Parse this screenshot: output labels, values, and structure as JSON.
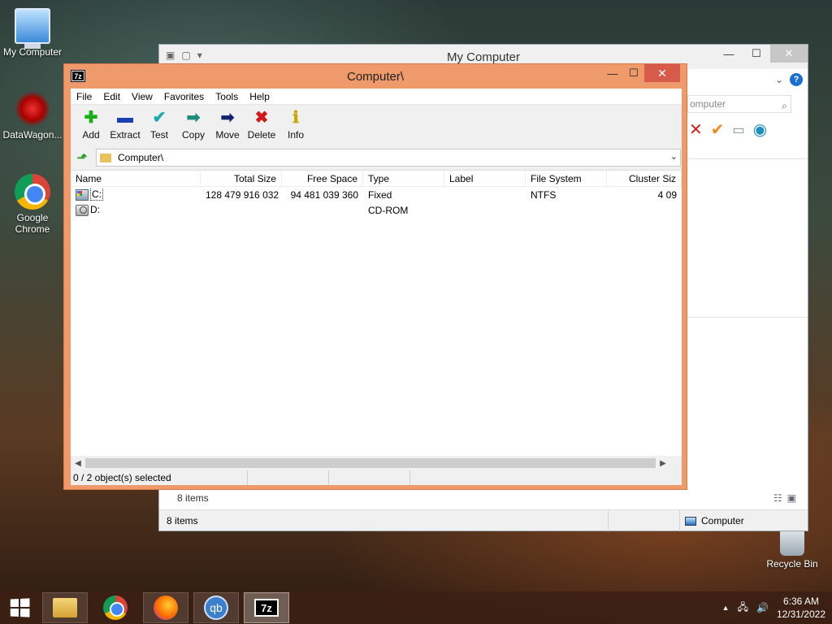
{
  "desktop": {
    "icons": [
      {
        "label": "My Computer"
      },
      {
        "label": "DataWagon..."
      },
      {
        "label": "Google Chrome"
      },
      {
        "label": "Recycle Bin"
      }
    ]
  },
  "explorer": {
    "title": "My Computer",
    "search_placeholder": "omputer",
    "items_count_pane": "8 items",
    "status_left": "8 items",
    "status_location": "Computer"
  },
  "zip": {
    "title": "Computer\\",
    "menu": [
      "File",
      "Edit",
      "View",
      "Favorites",
      "Tools",
      "Help"
    ],
    "toolbar": [
      {
        "label": "Add",
        "icon": "add-icon",
        "color": "#18b018",
        "glyph": "✚"
      },
      {
        "label": "Extract",
        "icon": "extract-icon",
        "color": "#1a3fb0",
        "glyph": "▬"
      },
      {
        "label": "Test",
        "icon": "test-icon",
        "color": "#1aa8b0",
        "glyph": "✔"
      },
      {
        "label": "Copy",
        "icon": "copy-icon",
        "color": "#1b8a7a",
        "glyph": "➡"
      },
      {
        "label": "Move",
        "icon": "move-icon",
        "color": "#13236e",
        "glyph": "➡"
      },
      {
        "label": "Delete",
        "icon": "delete-icon",
        "color": "#d01818",
        "glyph": "✖"
      },
      {
        "label": "Info",
        "icon": "info-icon",
        "color": "#c8a800",
        "glyph": "ℹ"
      }
    ],
    "address": "Computer\\",
    "columns": [
      "Name",
      "Total Size",
      "Free Space",
      "Type",
      "Label",
      "File System",
      "Cluster Siz"
    ],
    "rows": [
      {
        "name": "C:",
        "total": "128 479 916 032",
        "free": "94 481 039 360",
        "type": "Fixed",
        "label": "",
        "fs": "NTFS",
        "cluster": "4 09"
      },
      {
        "name": "D:",
        "total": "",
        "free": "",
        "type": "CD-ROM",
        "label": "",
        "fs": "",
        "cluster": ""
      }
    ],
    "status": "0 / 2 object(s) selected"
  },
  "taskbar": {
    "time": "6:36 AM",
    "date": "12/31/2022"
  }
}
